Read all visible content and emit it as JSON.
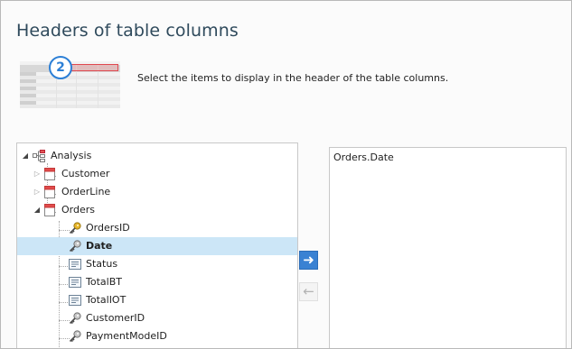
{
  "title": "Headers of table columns",
  "step_badge": "2",
  "description": "Select the items to display in the header of the table columns.",
  "tree": {
    "root": "Analysis",
    "nodes": [
      {
        "label": "Customer"
      },
      {
        "label": "OrderLine"
      },
      {
        "label": "Orders"
      },
      {
        "label": "OrdersID"
      },
      {
        "label": "Date"
      },
      {
        "label": "Status"
      },
      {
        "label": "TotalBT"
      },
      {
        "label": "TotalIOT"
      },
      {
        "label": "CustomerID"
      },
      {
        "label": "PaymentModeID"
      }
    ]
  },
  "selected_columns": [
    {
      "label": "Orders.Date"
    }
  ],
  "buttons": {
    "add_icon": "arrow-right-icon",
    "remove_icon": "arrow-left-icon"
  },
  "colors": {
    "accent": "#3a82d3",
    "selection": "#cce6f7",
    "badge": "#2c7fd6",
    "title": "#2f4a5c"
  }
}
